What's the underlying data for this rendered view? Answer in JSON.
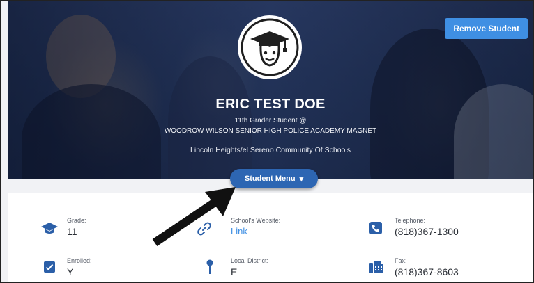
{
  "header": {
    "remove_label": "Remove Student",
    "student_name": "ERIC TEST DOE",
    "grade_line": "11th Grader Student @",
    "school_line": "WOODROW WILSON SENIOR HIGH POLICE ACADEMY MAGNET",
    "community_line": "Lincoln Heights/el Sereno Community Of Schools",
    "menu_label": "Student Menu",
    "menu_caret": "▾"
  },
  "info": {
    "grade": {
      "label": "Grade:",
      "value": "11",
      "icon": "graduation-cap-icon"
    },
    "enrolled": {
      "label": "Enrolled:",
      "value": "Y",
      "icon": "checkbox-icon"
    },
    "website": {
      "label": "School's Website:",
      "value": "Link",
      "icon": "link-icon"
    },
    "district": {
      "label": "Local District:",
      "value": "E",
      "icon": "map-pin-icon"
    },
    "telephone": {
      "label": "Telephone:",
      "value": "(818)367-1300",
      "icon": "phone-icon"
    },
    "fax": {
      "label": "Fax:",
      "value": "(818)367-8603",
      "icon": "fax-icon"
    }
  },
  "colors": {
    "accent": "#3f8fe3",
    "menu_button": "#2d66b3",
    "icon": "#2b5fa8",
    "hero": "#24355a"
  }
}
